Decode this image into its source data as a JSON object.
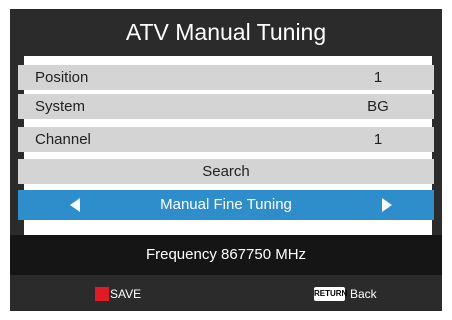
{
  "title": "ATV Manual Tuning",
  "menu": {
    "position": {
      "label": "Position",
      "value": "1"
    },
    "system": {
      "label": "System",
      "value": "BG"
    },
    "channel": {
      "label": "Channel",
      "value": "1"
    },
    "search": {
      "label": "Search"
    },
    "fine_tuning": {
      "label": "Manual Fine Tuning"
    }
  },
  "frequency": "Frequency 867750 MHz",
  "footer": {
    "save_label": "SAVE",
    "return_key": "RETURN",
    "back_label": "Back"
  },
  "colors": {
    "frame": "#2b2b2b",
    "row": "#d4d4d4",
    "selected": "#2e8dcb",
    "save_key": "#e01b24"
  },
  "icons": [
    "left-arrow-icon",
    "right-arrow-icon",
    "red-button-icon",
    "return-key-icon"
  ]
}
